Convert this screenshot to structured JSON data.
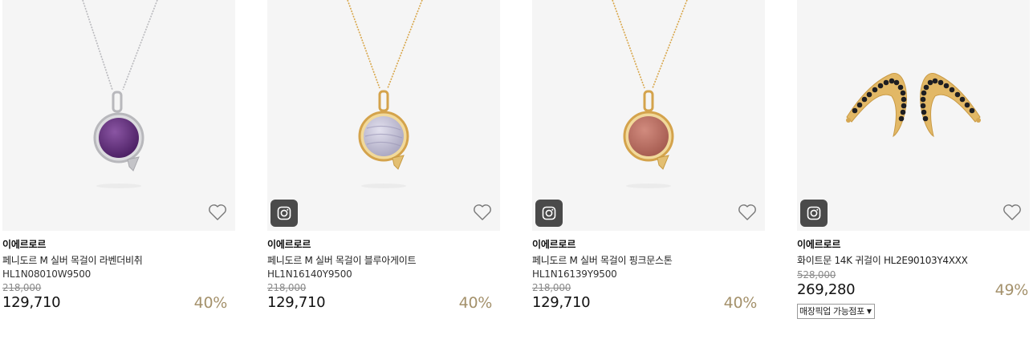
{
  "products": [
    {
      "brand": "이에르로르",
      "name": "페니도르 M 실버 목걸이 라벤더비취",
      "code": "HL1N08010W9500",
      "original_price": "218,000",
      "price": "129,710",
      "discount": "40%",
      "has_insta_badge": false,
      "metal_color": "#c9c9cc",
      "stone_color": "#5b2a73",
      "icons": [
        "jewelry-image",
        "heart-icon"
      ]
    },
    {
      "brand": "이에르로르",
      "name": "페니도르 M 실버 목걸이 블루아게이트",
      "code": "HL1N16140Y9500",
      "original_price": "218,000",
      "price": "129,710",
      "discount": "40%",
      "has_insta_badge": true,
      "metal_color": "#d9a84e",
      "stone_color": "#c7c6d9",
      "icons": [
        "jewelry-image",
        "instagram-icon",
        "heart-icon"
      ]
    },
    {
      "brand": "이에르로르",
      "name": "페니도르 M 실버 목걸이 핑크문스톤",
      "code": "HL1N16139Y9500",
      "original_price": "218,000",
      "price": "129,710",
      "discount": "40%",
      "has_insta_badge": true,
      "metal_color": "#d9a84e",
      "stone_color": "#b86a5e",
      "icons": [
        "jewelry-image",
        "instagram-icon",
        "heart-icon"
      ]
    },
    {
      "brand": "이에르로르",
      "name": "화이트문 14K 귀걸이 HL2E90103Y4XXX",
      "code": "",
      "original_price": "528,000",
      "price": "269,280",
      "discount": "49%",
      "has_insta_badge": true,
      "pickup_label": "매장픽업 가능점포",
      "metal_color": "#d9a84e",
      "stone_color": "#1e1e22",
      "icons": [
        "jewelry-image",
        "instagram-icon",
        "heart-icon",
        "caret-down-icon"
      ]
    }
  ],
  "colors": {
    "discount": "#a4916b",
    "thumb_background": "#f5f5f5",
    "insta_badge": "#4a4a4a"
  }
}
